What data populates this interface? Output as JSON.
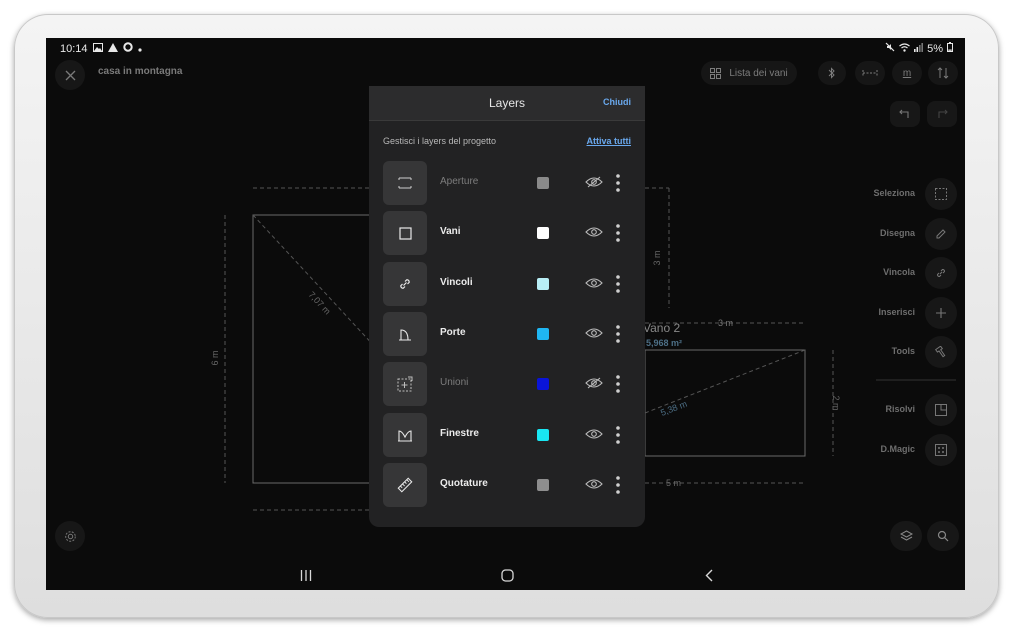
{
  "status": {
    "time": "10:14",
    "battery": "5%",
    "icons_left": [
      "image-icon",
      "warning-icon",
      "ring-icon",
      "dot-icon"
    ],
    "icons_right": [
      "mute-icon",
      "wifi-icon",
      "signal-icon",
      "battery-icon"
    ]
  },
  "project": {
    "name": "casa in montagna"
  },
  "toolbar": {
    "rooms_list": "Lista dei vani",
    "unit": "m"
  },
  "side_tools": [
    {
      "label": "Seleziona",
      "icon": "select-icon"
    },
    {
      "label": "Disegna",
      "icon": "pencil-icon"
    },
    {
      "label": "Vincola",
      "icon": "link-icon"
    },
    {
      "label": "Inserisci",
      "icon": "plus-icon"
    },
    {
      "label": "Tools",
      "icon": "hammer-icon"
    },
    {
      "label": "Risolvi",
      "icon": "resolve-icon"
    },
    {
      "label": "D.Magic",
      "icon": "magic-icon"
    }
  ],
  "drawing": {
    "room2_name": "Vano 2",
    "room2_area": "5,968 m²",
    "dim_6m": "6 m",
    "dim_3m_vertical": "3 m",
    "dim_3m_top": "3 m",
    "dim_2m": "2 m",
    "dim_5m": "5 m",
    "diag_1": "7,07 m",
    "diag_2": "5,38 m"
  },
  "layers_panel": {
    "title": "Layers",
    "close": "Chiudi",
    "subtitle": "Gestisci i layers del progetto",
    "activate_all": "Attiva tutti",
    "layers": [
      {
        "name": "Aperture",
        "color": "#8a8a8a",
        "active": false,
        "icon": "aperture-icon"
      },
      {
        "name": "Vani",
        "color": "#ffffff",
        "active": true,
        "icon": "square-icon"
      },
      {
        "name": "Vincoli",
        "color": "#b8eef5",
        "active": true,
        "icon": "link-icon"
      },
      {
        "name": "Porte",
        "color": "#1fb6f2",
        "active": true,
        "icon": "door-icon"
      },
      {
        "name": "Unioni",
        "color": "#0a14d8",
        "active": false,
        "icon": "union-icon"
      },
      {
        "name": "Finestre",
        "color": "#19e6f2",
        "active": true,
        "icon": "window-icon"
      },
      {
        "name": "Quotature",
        "color": "#8e8e8e",
        "active": true,
        "icon": "ruler-icon"
      }
    ]
  }
}
